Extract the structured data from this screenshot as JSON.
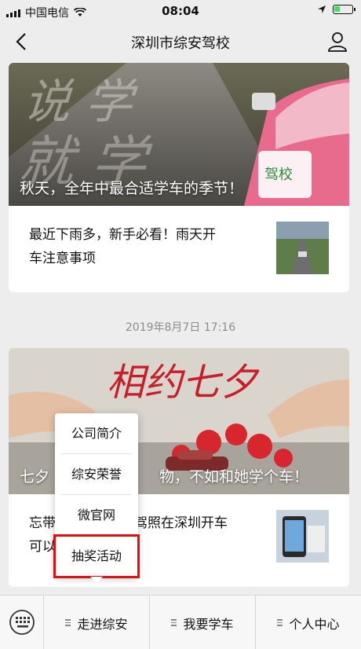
{
  "status": {
    "carrier": "中国电信",
    "time": "08:04"
  },
  "nav": {
    "title": "深圳市综安驾校",
    "back_icon": "back-chevron-icon",
    "user_icon": "user-icon"
  },
  "article1": {
    "hero_caption": "秋天，全年中最合适学车的季节！",
    "title_line1": "最近下雨多，新手必看！雨天开",
    "title_line2": "车注意事项"
  },
  "date_label": "2019年8月7日 17:16",
  "article2": {
    "hero_caption_left": "七夕",
    "hero_caption_right": "物，不如和她学个车！",
    "title_line1_left": "忘带",
    "title_line1_right": "驾照在深圳开车",
    "title_line2_left": "可以"
  },
  "menu": {
    "items": [
      "公司简介",
      "综安荣誉",
      "微官网",
      "抽奖活动"
    ],
    "highlight_color": "#e01010"
  },
  "bottom_bar": {
    "tabs": [
      "走进综安",
      "我要学车",
      "个人中心"
    ],
    "keyboard_icon": "keyboard-icon"
  }
}
